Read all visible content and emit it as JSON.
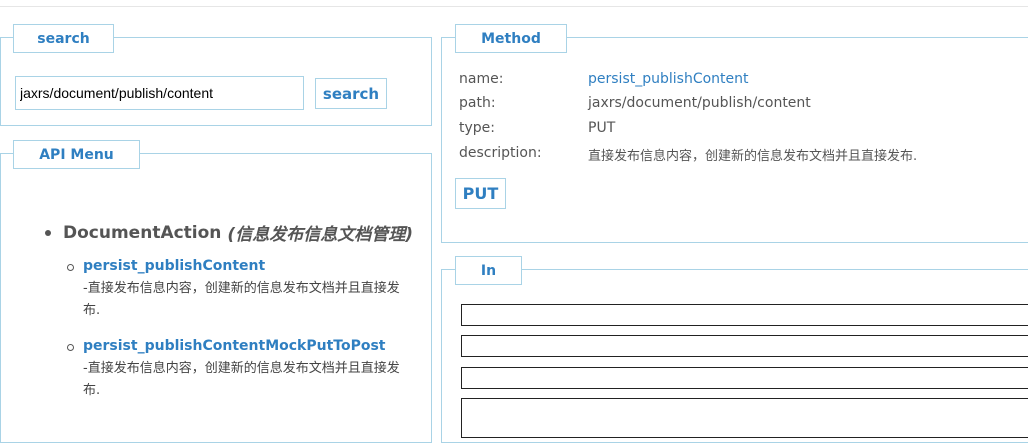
{
  "search": {
    "legend": "search",
    "input_value": "jaxrs/document/publish/content",
    "button_label": "search"
  },
  "menu": {
    "legend": "API Menu",
    "group": {
      "name": "DocumentAction",
      "subtitle": "(信息发布信息文档管理)"
    },
    "items": [
      {
        "name": "persist_publishContent",
        "desc": "-直接发布信息内容，创建新的信息发布文档并且直接发布."
      },
      {
        "name": "persist_publishContentMockPutToPost",
        "desc": "-直接发布信息内容，创建新的信息发布文档并且直接发布."
      }
    ]
  },
  "method": {
    "legend": "Method",
    "name_label": "name:",
    "name_value": "persist_publishContent",
    "path_label": "path:",
    "path_value": "jaxrs/document/publish/content",
    "type_label": "type:",
    "type_value": "PUT",
    "desc_label": "description:",
    "desc_value": "直接发布信息内容，创建新的信息发布文档并且直接发布.",
    "button_label": "PUT"
  },
  "in": {
    "legend": "In"
  },
  "colors": {
    "accent": "#2f7fc1",
    "border": "#a9d3e6",
    "text": "#555555"
  }
}
